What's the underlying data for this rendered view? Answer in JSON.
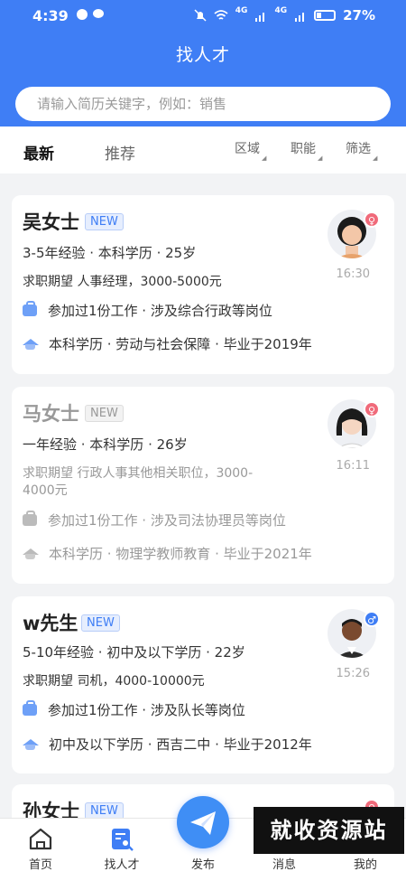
{
  "status": {
    "time": "4:39",
    "signal_a": "4G",
    "signal_b": "4G",
    "battery": "27%"
  },
  "header": {
    "title": "找人才"
  },
  "search": {
    "placeholder": "请输入简历关键字，例如：销售"
  },
  "tabs": [
    {
      "label": "最新"
    },
    {
      "label": "推荐"
    }
  ],
  "filters": [
    {
      "label": "区域"
    },
    {
      "label": "职能"
    },
    {
      "label": "筛选"
    }
  ],
  "colors": {
    "accent": "#3f7ef5",
    "female": "#f06a7a",
    "male": "#3f7ef5"
  },
  "candidates": [
    {
      "name": "吴女士",
      "badge": "NEW",
      "summary": "3-5年经验 · 本科学历 · 25岁",
      "expect_line1": "求职期望 人事经理，3000-5000元",
      "work": "参加过1份工作 · 涉及综合行政等岗位",
      "edu": "本科学历 · 劳动与社会保障 · 毕业于2019年",
      "time": "16:30",
      "gender_icon": "female-icon"
    },
    {
      "name": "马女士",
      "badge": "NEW",
      "summary": "一年经验 · 本科学历 · 26岁",
      "expect_line1": "求职期望 行政人事其他相关职位，3000-",
      "expect_line2": "4000元",
      "work": "参加过1份工作 · 涉及司法协理员等岗位",
      "edu": "本科学历 · 物理学教师教育 · 毕业于2021年",
      "time": "16:11",
      "gender_icon": "female-icon"
    },
    {
      "name": "w先生",
      "badge": "NEW",
      "summary": "5-10年经验 · 初中及以下学历 · 22岁",
      "expect_line1": "求职期望 司机，4000-10000元",
      "work": "参加过1份工作 · 涉及队长等岗位",
      "edu": "初中及以下学历 · 西吉二中 · 毕业于2012年",
      "time": "15:26",
      "gender_icon": "male-icon"
    },
    {
      "name": "孙女士",
      "badge": "NEW",
      "gender_icon": "female-icon"
    }
  ],
  "nav": [
    {
      "label": "首页",
      "icon": "home-icon"
    },
    {
      "label": "找人才",
      "icon": "find-talent-icon"
    },
    {
      "label": "发布",
      "icon": "publish-icon"
    },
    {
      "label": "消息",
      "icon": "message-icon"
    },
    {
      "label": "我的",
      "icon": "profile-icon"
    }
  ],
  "watermark": "就收资源站"
}
